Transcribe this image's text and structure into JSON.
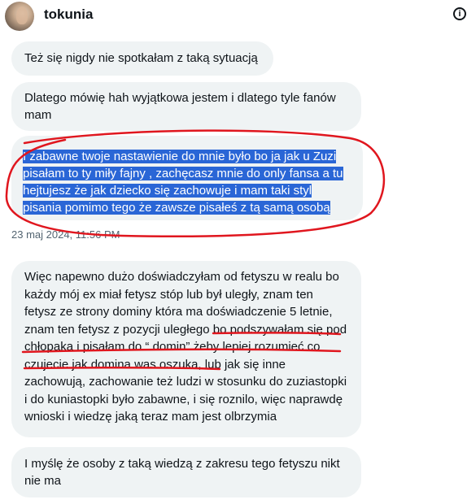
{
  "header": {
    "username": "tokunia",
    "info_icon": "info-icon"
  },
  "messages": [
    {
      "text": "Też się nigdy nie spotkałam z taką sytuacją"
    },
    {
      "text": "Dlatego mówię hah wyjątkowa jestem i dlatego tyle fanów mam"
    },
    {
      "text": "I zabawne twoje nastawienie do mnie było bo ja jak u Zuzi pisałam to ty miły fajny , zachęcasz mnie do only fansa a tu hejtujesz że jak dziecko się zachowuje i mam taki styl pisania pomimo tego że zawsze pisałeś z tą samą osobą",
      "highlighted": true
    },
    {
      "text": "Więc napewno dużo doświadczyłam od fetyszu w realu bo każdy mój ex miał fetysz stóp lub był uległy, znam ten fetysz ze strony dominy która ma doświadczenie 5 letnie, znam ten fetysz z pozycji uległego bo podszywałam się pod chłopaka i pisałam do “ domin” żeby lepiej rozumieć co czujecie jak domina was oszuka, lub jak się inne zachowują, zachowanie też ludzi w stosunku do zuziastopki i do kuniastopki było zabawne, i się roznilo, więc naprawdę wnioski i wiedzę jaką teraz mam jest olbrzymia"
    },
    {
      "text": "I myślę że osoby z taką wiedzą z zakresu tego fetyszu nikt nie ma"
    }
  ],
  "timestamp": "23 maj 2024, 11:56 PM",
  "colors": {
    "bubble_bg": "#eff3f4",
    "selection": "#2a66d6",
    "annotation_red": "#e0161e",
    "timestamp": "#536471"
  }
}
